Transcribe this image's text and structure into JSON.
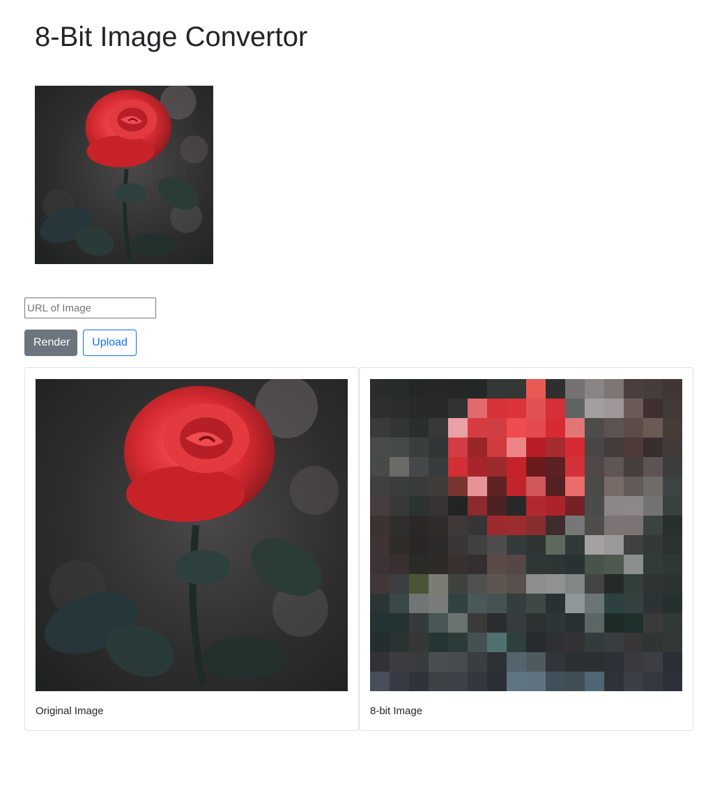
{
  "page": {
    "title": "8-Bit Image Convertor"
  },
  "form": {
    "url_placeholder": "URL of Image",
    "url_value": "",
    "render_label": "Render",
    "upload_label": "Upload"
  },
  "results": {
    "original_caption": "Original Image",
    "pixel_caption": "8-bit Image"
  },
  "colors": {
    "render_button": "#6c757d",
    "upload_button": "#0d6efd",
    "card_border": "#dee2e6"
  },
  "pixel_grid": {
    "columns": 16,
    "rows": 16,
    "cells": [
      "#2b2b2b",
      "#272b2a",
      "#232827",
      "#262727",
      "#252726",
      "#232727",
      "#343738",
      "#353636",
      "#e95a55",
      "#2f2f2f",
      "#747170",
      "#8b8484",
      "#7d7675",
      "#4a3f3e",
      "#463c3c",
      "#403635",
      "#2e2f2d",
      "#2c2e2c",
      "#282a29",
      "#282a29",
      "#323331",
      "#e26a6e",
      "#d73237",
      "#da343a",
      "#e25254",
      "#d72f37",
      "#5f6460",
      "#a19f9f",
      "#9f9797",
      "#6b5b58",
      "#3e2f30",
      "#423a38",
      "#3b3a38",
      "#323536",
      "#292f2f",
      "#363938",
      "#eaa1a5",
      "#d73c43",
      "#d03e43",
      "#ef4c4f",
      "#e44b4e",
      "#d72b32",
      "#e27677",
      "#4c4c4a",
      "#5d5451",
      "#5b4c47",
      "#6a5a53",
      "#483c39",
      "#4a4b49",
      "#464a49",
      "#3b3e3f",
      "#333636",
      "#d33c45",
      "#9a2628",
      "#d23b3e",
      "#ed8588",
      "#b81e26",
      "#a52b2f",
      "#d62b32",
      "#4b4644",
      "#433c3a",
      "#4e3b39",
      "#3a2d2d",
      "#433b3a",
      "#484a48",
      "#6a6b66",
      "#444848",
      "#393c3c",
      "#d22f37",
      "#a8262b",
      "#9c2b2d",
      "#c5232a",
      "#6b1a1b",
      "#5b2123",
      "#d4323a",
      "#514748",
      "#5f5552",
      "#463e3b",
      "#5d5353",
      "#3c3d3c",
      "#3f4140",
      "#393d3d",
      "#383b3a",
      "#3f3c3a",
      "#7a3533",
      "#e69397",
      "#5e2222",
      "#c2242c",
      "#d1585b",
      "#562123",
      "#ec6c6b",
      "#4a4b47",
      "#786a67",
      "#625b58",
      "#6e6b68",
      "#3e4443",
      "#473d3c",
      "#383838",
      "#2c3132",
      "#383433",
      "#212424",
      "#8c2a2d",
      "#4d2223",
      "#282828",
      "#b32830",
      "#ae232a",
      "#742127",
      "#494c49",
      "#8c8586",
      "#8e8789",
      "#747373",
      "#3a4241",
      "#3a3330",
      "#2f2e2c",
      "#292827",
      "#312b2a",
      "#3f3838",
      "#353535",
      "#9d2b2e",
      "#9d2c2d",
      "#892e2f",
      "#402b2d",
      "#767877",
      "#4f4d4a",
      "#7c7374",
      "#7b7374",
      "#3c4241",
      "#28302f",
      "#3f3433",
      "#2f2c2a",
      "#2a2624",
      "#2d2b2a",
      "#3a3635",
      "#404140",
      "#4f4d4b",
      "#353a3a",
      "#2f3533",
      "#5c6a5d",
      "#313839",
      "#a4a1a2",
      "#9b9899",
      "#3f4141",
      "#323938",
      "#2b3231",
      "#3e3333",
      "#392f2e",
      "#2a2b27",
      "#2f2a27",
      "#393130",
      "#342f2f",
      "#5a4a48",
      "#544746",
      "#2f3636",
      "#2d3535",
      "#293232",
      "#48534e",
      "#50594f",
      "#8a8f8d",
      "#323b3a",
      "#2f3835",
      "#433737",
      "#3b3f3f",
      "#4b5436",
      "#7b7d73",
      "#3f4340",
      "#4f514d",
      "#5e5450",
      "#58504c",
      "#8b8e8c",
      "#8f9290",
      "#808784",
      "#424544",
      "#252928",
      "#334039",
      "#2f3433",
      "#2c3431",
      "#2b3534",
      "#3a4948",
      "#6f7674",
      "#787d7b",
      "#324141",
      "#4a585a",
      "#445352",
      "#353d3e",
      "#3d4847",
      "#283133",
      "#92989a",
      "#6b7674",
      "#2d4240",
      "#334140",
      "#2d3334",
      "#25302f",
      "#233232",
      "#253333",
      "#353a3a",
      "#485656",
      "#687372",
      "#3b3a3a",
      "#2b2c2f",
      "#363c3d",
      "#2c3132",
      "#2e3536",
      "#283033",
      "#5b6665",
      "#1d2c29",
      "#1f2f2c",
      "#3a3a3a",
      "#333838",
      "#252e2e",
      "#2b3333",
      "#363737",
      "#253533",
      "#2c3b38",
      "#445150",
      "#507170",
      "#2d403e",
      "#272a2e",
      "#2e3035",
      "#343234",
      "#343b3d",
      "#3a3d40",
      "#383537",
      "#313434",
      "#343737",
      "#313235",
      "#3d3c40",
      "#3a3b3d",
      "#494e52",
      "#484b4d",
      "#3a3d42",
      "#2d3135",
      "#53646c",
      "#4d5a5f",
      "#31353b",
      "#2b2f34",
      "#2b2e33",
      "#2d3036",
      "#393b40",
      "#3c3e43",
      "#2c2f35",
      "#494e5b",
      "#393b44",
      "#30343a",
      "#3d4247",
      "#3d4046",
      "#34373d",
      "#2b2e35",
      "#5f7584",
      "#5f7281",
      "#3f505b",
      "#404d55",
      "#4f6774",
      "#2e3339",
      "#3c3f47",
      "#363840",
      "#2e3039"
    ]
  }
}
